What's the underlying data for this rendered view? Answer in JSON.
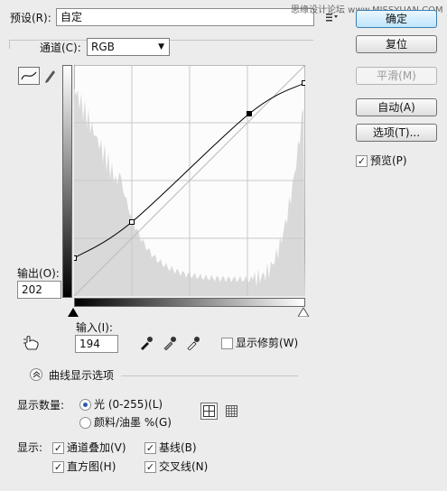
{
  "watermark": "思缘设计论坛  www.MISSYUAN.COM",
  "preset": {
    "label": "预设(R):",
    "value": "自定",
    "icon": "preset-options-icon"
  },
  "channel": {
    "label": "通道(C):",
    "value": "RGB"
  },
  "buttons": {
    "ok": "确定",
    "reset": "复位",
    "smooth": "平滑(M)",
    "auto": "自动(A)",
    "options": "选项(T)..."
  },
  "preview": {
    "label": "预览(P)",
    "checked": true
  },
  "curve": {
    "output_label": "输出(O):",
    "output_value": "202",
    "input_label": "输入(I):",
    "input_value": "194",
    "points": [
      [
        0,
        42
      ],
      [
        64,
        82
      ],
      [
        194,
        202
      ],
      [
        255,
        236
      ]
    ],
    "selected_point_input": 194
  },
  "show_clipping": {
    "label": "显示修剪(W)",
    "checked": false
  },
  "display_options": {
    "title": "曲线显示选项",
    "amount_label": "显示数量:",
    "light_option": "光 (0-255)(L)",
    "pigment_option": "颜料/油墨 %(G)",
    "light_selected": true,
    "show_label": "显示:",
    "channel_overlays": {
      "label": "通道叠加(V)",
      "checked": true
    },
    "baseline": {
      "label": "基线(B)",
      "checked": true
    },
    "histogram": {
      "label": "直方图(H)",
      "checked": true
    },
    "intersection": {
      "label": "交叉线(N)",
      "checked": true
    }
  },
  "colors": {
    "background": "#ececec",
    "grid": "#c9c9c9",
    "histogram": "#d9d9d9",
    "curve": "#000000",
    "primary_button": "#bee6fd"
  }
}
